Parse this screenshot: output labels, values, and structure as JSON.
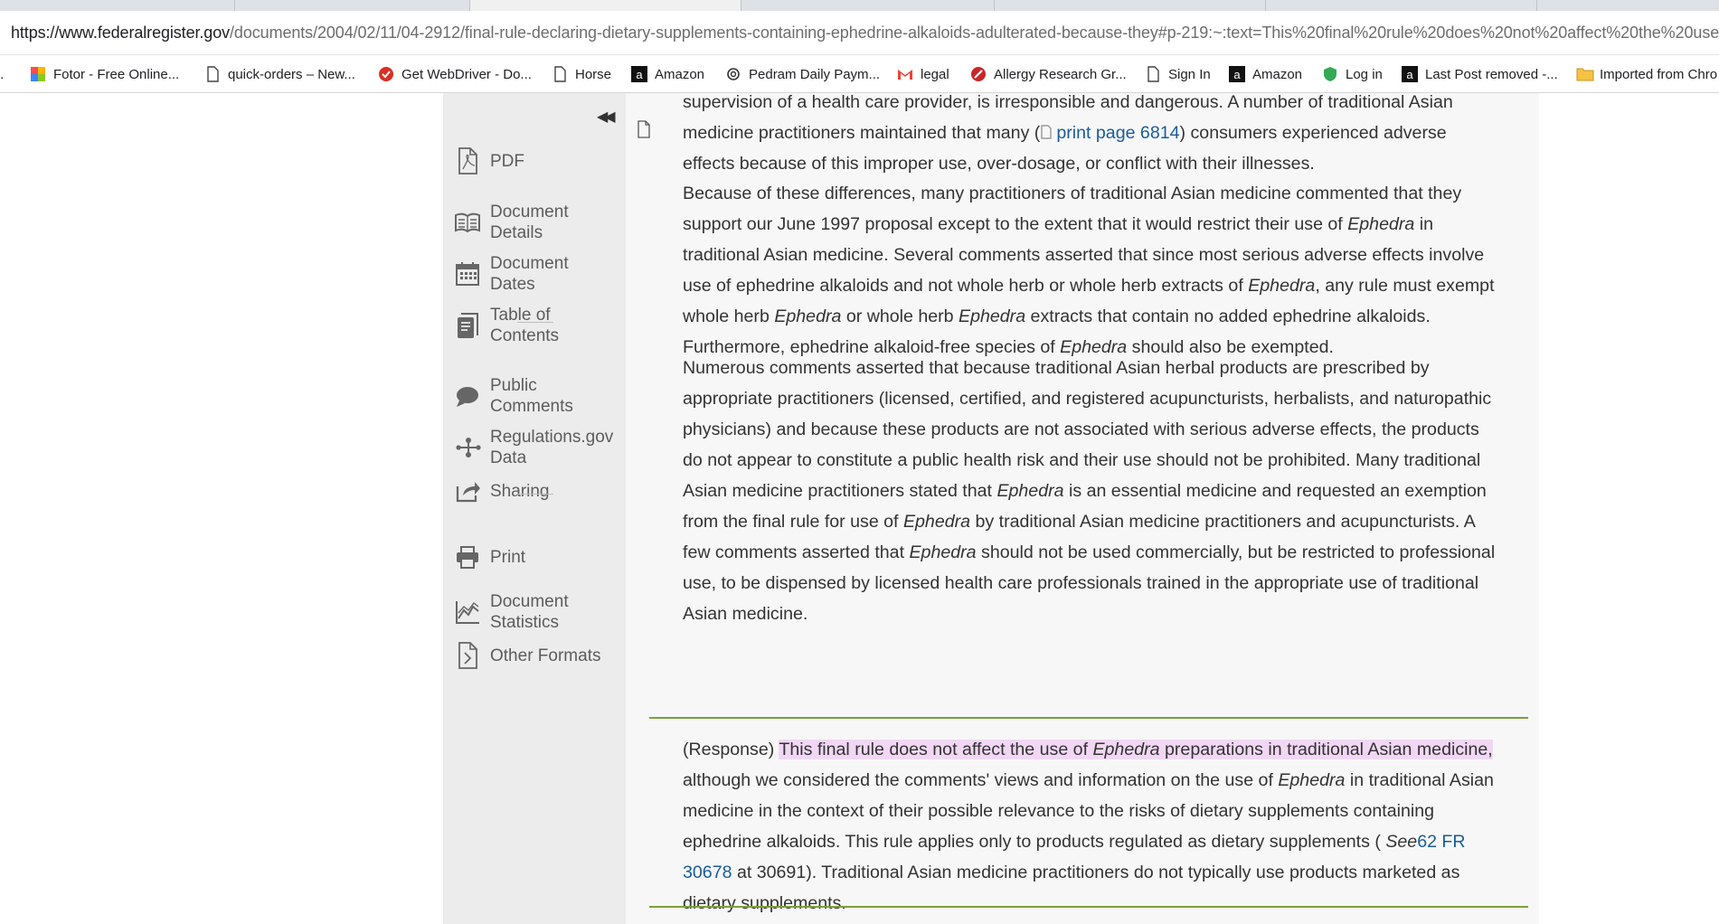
{
  "browser": {
    "url_host": "https://www.federalregister.gov",
    "url_path": "/documents/2004/02/11/04-2912/final-rule-declaring-dietary-supplements-containing-ephedrine-alkaloids-adulterated-because-they#p-219:~:text=This%20final%20rule%20does%20not%20affect%20the%20use%",
    "bookmarks": [
      {
        "label": "Fotor - Free Online...",
        "icon": "fotor-icon"
      },
      {
        "label": "quick-orders – New...",
        "icon": "page-icon"
      },
      {
        "label": "Get WebDriver - Do...",
        "icon": "webdriver-icon"
      },
      {
        "label": "Horse",
        "icon": "page-icon"
      },
      {
        "label": "Amazon",
        "icon": "amazon-icon"
      },
      {
        "label": "Pedram Daily Paym...",
        "icon": "openai-icon"
      },
      {
        "label": "legal",
        "icon": "gmail-icon"
      },
      {
        "label": "Allergy Research Gr...",
        "icon": "allergy-icon"
      },
      {
        "label": "Sign In",
        "icon": "page-icon"
      },
      {
        "label": "Amazon",
        "icon": "amazon-icon"
      },
      {
        "label": "Log in",
        "icon": "shield-icon"
      },
      {
        "label": "Last Post removed -...",
        "icon": "amazon-icon"
      },
      {
        "label": "Imported from Chro",
        "icon": "folder-icon"
      }
    ]
  },
  "sidebar": {
    "items": [
      {
        "label": "PDF",
        "icon": "pdf-icon"
      },
      {
        "label": "Document\nDetails",
        "icon": "book-icon"
      },
      {
        "label": "Document\nDates",
        "icon": "calendar-icon"
      },
      {
        "label": "Table of\nContents",
        "icon": "toc-icon"
      },
      {
        "label": "Public\nComments",
        "icon": "comment-icon"
      },
      {
        "label": "Regulations.gov\nData",
        "icon": "share-nodes-icon"
      },
      {
        "label": "Sharing",
        "icon": "share-icon"
      },
      {
        "label": "Print",
        "icon": "printer-icon"
      },
      {
        "label": "Document\nStatistics",
        "icon": "chart-icon"
      },
      {
        "label": "Other Formats",
        "icon": "file-code-icon"
      }
    ]
  },
  "content": {
    "p1_line1": "supervision of a health care provider, is irresponsible and dangerous. A number of traditional Asian",
    "p1_line2_a": "medicine practitioners maintained that many (",
    "print_page": "print page 6814",
    "p1_line2_b": ") consumers experienced adverse",
    "p1_line3": "effects because of this improper use, over-dosage, or conflict with their illnesses.",
    "p2": [
      "Because of these differences, many practitioners of traditional Asian medicine commented that they",
      "support our June 1997 proposal except to the extent that it would restrict their use of ",
      "Ephedra",
      " in",
      "traditional Asian medicine. Several comments asserted that since most serious adverse effects involve",
      "use of ephedrine alkaloids and not whole herb or whole herb extracts of ",
      "Ephedra",
      ", any rule must exempt",
      "whole herb ",
      "Ephedra",
      " or whole herb ",
      "Ephedra",
      " extracts that contain no added ephedrine alkaloids.",
      "Furthermore, ephedrine alkaloid-free species of ",
      "Ephedra",
      " should also be exempted."
    ],
    "p3": [
      "Numerous comments asserted that because traditional Asian herbal products are prescribed by",
      "appropriate practitioners (licensed, certified, and registered acupuncturists, herbalists, and naturopathic",
      "physicians) and because these products are not associated with serious adverse effects, the products",
      "do not appear to constitute a public health risk and their use should not be prohibited. Many traditional",
      "Asian medicine practitioners stated that ",
      "Ephedra",
      " is an essential medicine and requested an exemption",
      "from the final rule for use of ",
      "Ephedra",
      " by traditional Asian medicine practitioners and acupuncturists. A",
      "few comments asserted that ",
      "Ephedra",
      " should not be used commercially, but be restricted to professional",
      "use, to be dispensed by licensed health care professionals trained in the appropriate use of traditional",
      "Asian medicine."
    ],
    "p4": [
      "(Response) ",
      "This final rule does not affect the use of ",
      "Ephedra",
      " preparations in traditional Asian medicine,",
      "although we considered the comments' views and information on the use of ",
      "Ephedra",
      " in traditional Asian",
      "medicine in the context of their possible relevance to the risks of dietary supplements containing",
      "ephedrine alkaloids. This rule applies only to products regulated as dietary supplements ( ",
      "See",
      "62 FR",
      "30678",
      " at 30691). Traditional Asian medicine practitioners do not typically use products marketed as",
      "dietary supplements."
    ]
  },
  "colors": {
    "highlight": "#f1d7f3",
    "link": "#1a5c99",
    "rule": "#7aa23a",
    "sidebar_bg": "#ececec"
  }
}
